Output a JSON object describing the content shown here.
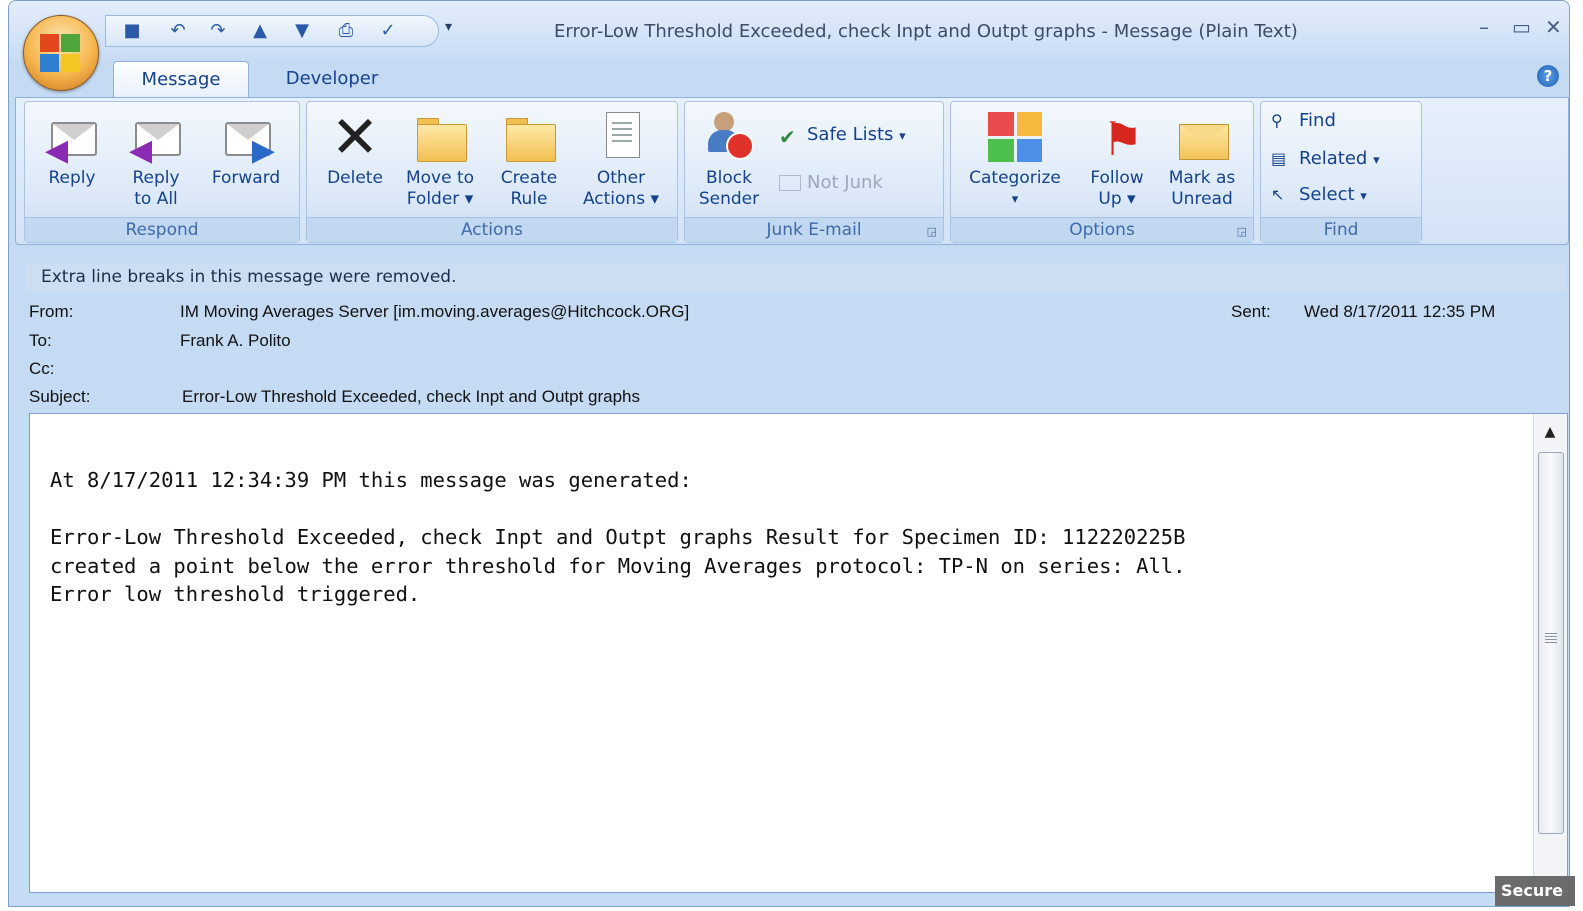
{
  "window": {
    "title": "Error-Low Threshold Exceeded, check Inpt and Outpt graphs - Message (Plain Text)",
    "controls": [
      "–",
      "▭",
      "✕"
    ]
  },
  "quick_access": {
    "icons": [
      "save-icon",
      "undo-icon",
      "redo-icon",
      "previous-item-icon",
      "next-item-icon",
      "print-icon",
      "spelling-icon"
    ],
    "more": "▾"
  },
  "tabs": [
    {
      "label": "Message",
      "active": true
    },
    {
      "label": "Developer",
      "active": false
    }
  ],
  "ribbon": {
    "respond": {
      "label": "Respond",
      "reply": "Reply",
      "reply_all_1": "Reply",
      "reply_all_2": "to All",
      "forward": "Forward"
    },
    "actions": {
      "label": "Actions",
      "delete": "Delete",
      "move_1": "Move to",
      "move_2": "Folder",
      "rule_1": "Create",
      "rule_2": "Rule",
      "other_1": "Other",
      "other_2": "Actions"
    },
    "junk": {
      "label": "Junk E-mail",
      "block_1": "Block",
      "block_2": "Sender",
      "safe_lists": "Safe Lists",
      "not_junk": "Not Junk"
    },
    "options": {
      "label": "Options",
      "categorize": "Categorize",
      "follow_1": "Follow",
      "follow_2": "Up",
      "mark_1": "Mark as",
      "mark_2": "Unread"
    },
    "find": {
      "label": "Find",
      "find": "Find",
      "related": "Related",
      "select": "Select"
    },
    "dropdown_caret": "▾"
  },
  "infobar": "Extra line breaks in this message were removed.",
  "header": {
    "from_label": "From:",
    "from_value": "IM Moving Averages Server [im.moving.averages@Hitchcock.ORG]",
    "sent_label": "Sent:",
    "sent_value": "Wed 8/17/2011 12:35 PM",
    "to_label": "To:",
    "to_value": "Frank A. Polito",
    "cc_label": "Cc:",
    "cc_value": "",
    "subject_label": "Subject:",
    "subject_value": "Error-Low Threshold Exceeded, check Inpt and Outpt graphs"
  },
  "body": {
    "line1": "At 8/17/2011 12:34:39 PM this message was generated:",
    "line2": "Error-Low Threshold Exceeded, check Inpt and Outpt graphs Result for Specimen ID: 112220225B",
    "line3": "created a point below the error threshold for Moving Averages protocol: TP-N on series: All.",
    "line4": "Error low threshold triggered."
  },
  "secure_tag": "Secure",
  "colors": {
    "ribbon_text": "#15428b",
    "window_bg": "#c5daf3",
    "flag_red": "#d7261e"
  }
}
